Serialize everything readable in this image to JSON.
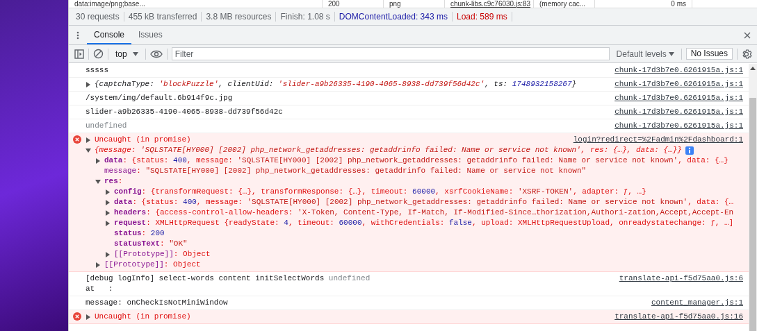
{
  "network_row": {
    "cells": [
      {
        "text": "data:image/png;base...",
        "kind": "plain"
      },
      {
        "text": "200",
        "kind": "plain"
      },
      {
        "text": "png",
        "kind": "plain"
      },
      {
        "text": "chunk-libs.c9c76030.js:83",
        "kind": "link"
      },
      {
        "text": "(memory cac...",
        "kind": "plain"
      },
      {
        "text": "0 ms",
        "kind": "right"
      }
    ]
  },
  "status_bar": [
    {
      "text": "30 requests",
      "kind": "plain"
    },
    {
      "text": "455 kB transferred",
      "kind": "plain"
    },
    {
      "text": "3.8 MB resources",
      "kind": "plain"
    },
    {
      "text": "Finish: 1.08 s",
      "kind": "plain"
    },
    {
      "text": "DOMContentLoaded: 343 ms",
      "kind": "blue"
    },
    {
      "text": "Load: 589 ms",
      "kind": "red"
    }
  ],
  "drawer_tabs": [
    {
      "label": "Console",
      "selected": true
    },
    {
      "label": "Issues",
      "selected": false
    }
  ],
  "toolbar": {
    "context": "top",
    "filter": {
      "placeholder": "Filter"
    },
    "levels": "Default levels",
    "issues": "No Issues"
  },
  "messages": [
    {
      "kind": "log",
      "source": "chunk-17d3b7e0.6261915a.js:1",
      "rows": [
        {
          "tokens": [
            {
              "t": "sssss"
            }
          ]
        }
      ]
    },
    {
      "kind": "log",
      "source": "chunk-17d3b7e0.6261915a.js:1",
      "rows": [
        {
          "italic": true,
          "expanded": false,
          "tokens": [
            {
              "t": "{captchaType: "
            },
            {
              "t": "'blockPuzzle'",
              "kind": "str"
            },
            {
              "t": ", clientUid: "
            },
            {
              "t": "'slider-a9b26335-4190-4065-8938-dd739f56d42c'",
              "kind": "str"
            },
            {
              "t": ", ts: "
            },
            {
              "t": "1748932158267",
              "kind": "num"
            },
            {
              "t": "}"
            }
          ]
        }
      ]
    },
    {
      "kind": "log",
      "source": "chunk-17d3b7e0.6261915a.js:1",
      "rows": [
        {
          "tokens": [
            {
              "t": "/system/img/default.6b914f9c.jpg"
            }
          ]
        }
      ]
    },
    {
      "kind": "log",
      "source": "chunk-17d3b7e0.6261915a.js:1",
      "rows": [
        {
          "tokens": [
            {
              "t": "slider-a9b26335-4190-4065-8938-dd739f56d42c"
            }
          ]
        }
      ]
    },
    {
      "kind": "log",
      "source": "chunk-17d3b7e0.6261915a.js:1",
      "rows": [
        {
          "tokens": [
            {
              "t": "undefined",
              "kind": "muted"
            }
          ]
        }
      ]
    },
    {
      "kind": "error",
      "source": "login?redirect=%2Fadmin%2Fdashboard:1",
      "rows": [
        {
          "expanded": false,
          "tokens": [
            {
              "t": "Uncaught (in promise)"
            }
          ]
        },
        {
          "italic": true,
          "info": true,
          "expanded": true,
          "tokens": [
            {
              "t": "{message: "
            },
            {
              "t": "'SQLSTATE[HY000] [2002] php_network_getaddresses: getaddrinfo failed: Name or service not known'",
              "kind": "str"
            },
            {
              "t": ", res: {…}, data: {…}}"
            }
          ],
          "children": [
            {
              "expanded": false,
              "tokens": [
                {
                  "t": "data",
                  "kind": "key"
                },
                {
                  "t": ": {status: "
                },
                {
                  "t": "400",
                  "kind": "num"
                },
                {
                  "t": ", message: "
                },
                {
                  "t": "'SQLSTATE[HY000] [2002] php_network_getaddresses: getaddrinfo failed: Name or service not known'",
                  "kind": "str"
                },
                {
                  "t": ", data: {…}"
                }
              ]
            },
            {
              "tokens": [
                {
                  "t": "message",
                  "kind": "keydim"
                },
                {
                  "t": ": "
                },
                {
                  "t": "\"SQLSTATE[HY000] [2002] php_network_getaddresses: getaddrinfo failed: Name or service not known\"",
                  "kind": "str"
                }
              ]
            },
            {
              "expanded": true,
              "tokens": [
                {
                  "t": "res",
                  "kind": "key"
                },
                {
                  "t": ":"
                }
              ],
              "children": [
                {
                  "expanded": false,
                  "tokens": [
                    {
                      "t": "config",
                      "kind": "key"
                    },
                    {
                      "t": ": {transformRequest: {…}, transformResponse: {…}, timeout: "
                    },
                    {
                      "t": "60000",
                      "kind": "num"
                    },
                    {
                      "t": ", xsrfCookieName: "
                    },
                    {
                      "t": "'XSRF-TOKEN'",
                      "kind": "str"
                    },
                    {
                      "t": ", adapter: ƒ, …}"
                    }
                  ]
                },
                {
                  "expanded": false,
                  "tokens": [
                    {
                      "t": "data",
                      "kind": "key"
                    },
                    {
                      "t": ": {status: "
                    },
                    {
                      "t": "400",
                      "kind": "num"
                    },
                    {
                      "t": ", message: "
                    },
                    {
                      "t": "'SQLSTATE[HY000] [2002] php_network_getaddresses: getaddrinfo failed: Name or service not known'",
                      "kind": "str"
                    },
                    {
                      "t": ", data: {…"
                    }
                  ]
                },
                {
                  "expanded": false,
                  "tokens": [
                    {
                      "t": "headers",
                      "kind": "key"
                    },
                    {
                      "t": ": {access-control-allow-headers: "
                    },
                    {
                      "t": "'X-Token, Content-Type, If-Match, If-Modified-Since…thorization,Authori-zation,Accept,Accept-En",
                      "kind": "str"
                    }
                  ]
                },
                {
                  "expanded": false,
                  "tokens": [
                    {
                      "t": "request",
                      "kind": "key"
                    },
                    {
                      "t": ": XMLHttpRequest {readyState: "
                    },
                    {
                      "t": "4",
                      "kind": "num"
                    },
                    {
                      "t": ", timeout: "
                    },
                    {
                      "t": "60000",
                      "kind": "num"
                    },
                    {
                      "t": ", withCredentials: "
                    },
                    {
                      "t": "false",
                      "kind": "num"
                    },
                    {
                      "t": ", upload: XMLHttpRequestUpload, onreadystatechange: ƒ, …]"
                    }
                  ]
                },
                {
                  "tokens": [
                    {
                      "t": "status",
                      "kind": "key"
                    },
                    {
                      "t": ": "
                    },
                    {
                      "t": "200",
                      "kind": "num"
                    }
                  ]
                },
                {
                  "tokens": [
                    {
                      "t": "statusText",
                      "kind": "key"
                    },
                    {
                      "t": ": "
                    },
                    {
                      "t": "\"OK\"",
                      "kind": "str"
                    }
                  ]
                },
                {
                  "expanded": false,
                  "tokens": [
                    {
                      "t": "[[Prototype]]",
                      "kind": "keydim"
                    },
                    {
                      "t": ": Object"
                    }
                  ]
                }
              ]
            },
            {
              "expanded": false,
              "tokens": [
                {
                  "t": "[[Prototype]]",
                  "kind": "keydim"
                },
                {
                  "t": ": Object"
                }
              ]
            }
          ]
        }
      ]
    },
    {
      "kind": "log",
      "source": "translate-api-f5d75aa0.js:6",
      "rows": [
        {
          "tokens": [
            {
              "t": "[debug logInfo] select-words content initSelectWords "
            },
            {
              "t": "undefined",
              "kind": "muted"
            }
          ]
        },
        {
          "tokens": [
            {
              "t": "at   :"
            }
          ]
        }
      ]
    },
    {
      "kind": "log",
      "source": "content_manager.js:1",
      "rows": [
        {
          "tokens": [
            {
              "t": "message: onCheckIsNotMiniWindow"
            }
          ]
        }
      ]
    },
    {
      "kind": "error",
      "source": "translate-api-f5d75aa0.js:16",
      "rows": [
        {
          "expanded": false,
          "tokens": [
            {
              "t": "Uncaught (in promise)"
            }
          ]
        }
      ]
    }
  ]
}
